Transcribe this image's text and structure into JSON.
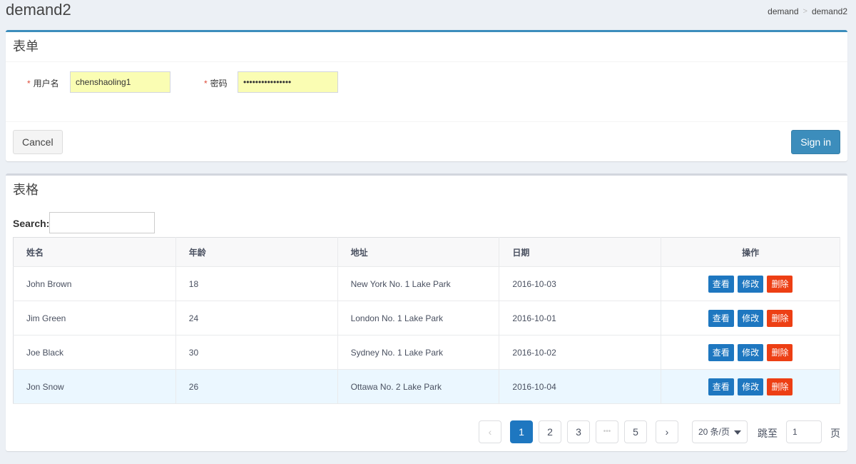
{
  "page": {
    "title": "demand2"
  },
  "breadcrumb": {
    "items": [
      "demand",
      "demand2"
    ],
    "separator": ">"
  },
  "form": {
    "title": "表单",
    "username": {
      "label": "用户名",
      "value": "chenshaoling1",
      "required_mark": "*"
    },
    "password": {
      "label": "密码",
      "value": "••••••••••••••••",
      "required_mark": "*"
    },
    "cancel_label": "Cancel",
    "signin_label": "Sign in"
  },
  "table": {
    "title": "表格",
    "search_label": "Search:",
    "search_value": "",
    "columns": [
      "姓名",
      "年龄",
      "地址",
      "日期",
      "操作"
    ],
    "rows": [
      {
        "name": "John Brown",
        "age": "18",
        "address": "New York No. 1 Lake Park",
        "date": "2016-10-03"
      },
      {
        "name": "Jim Green",
        "age": "24",
        "address": "London No. 1 Lake Park",
        "date": "2016-10-01"
      },
      {
        "name": "Joe Black",
        "age": "30",
        "address": "Sydney No. 1 Lake Park",
        "date": "2016-10-02"
      },
      {
        "name": "Jon Snow",
        "age": "26",
        "address": "Ottawa No. 2 Lake Park",
        "date": "2016-10-04"
      }
    ],
    "actions": {
      "view": "查看",
      "edit": "修改",
      "delete": "删除"
    },
    "highlighted_row": 3
  },
  "pagination": {
    "prev_icon": "‹",
    "next_icon": "›",
    "pages": [
      "1",
      "2",
      "3",
      "•••",
      "5"
    ],
    "current": "1",
    "page_size": "20 条/页",
    "jump_label": "跳至",
    "jump_value": "1",
    "page_suffix": "页"
  },
  "colors": {
    "primary": "#1e77c0",
    "danger": "#ed3f14",
    "form_box_top": "#3c8dbc",
    "autofill": "#fafdb3"
  }
}
